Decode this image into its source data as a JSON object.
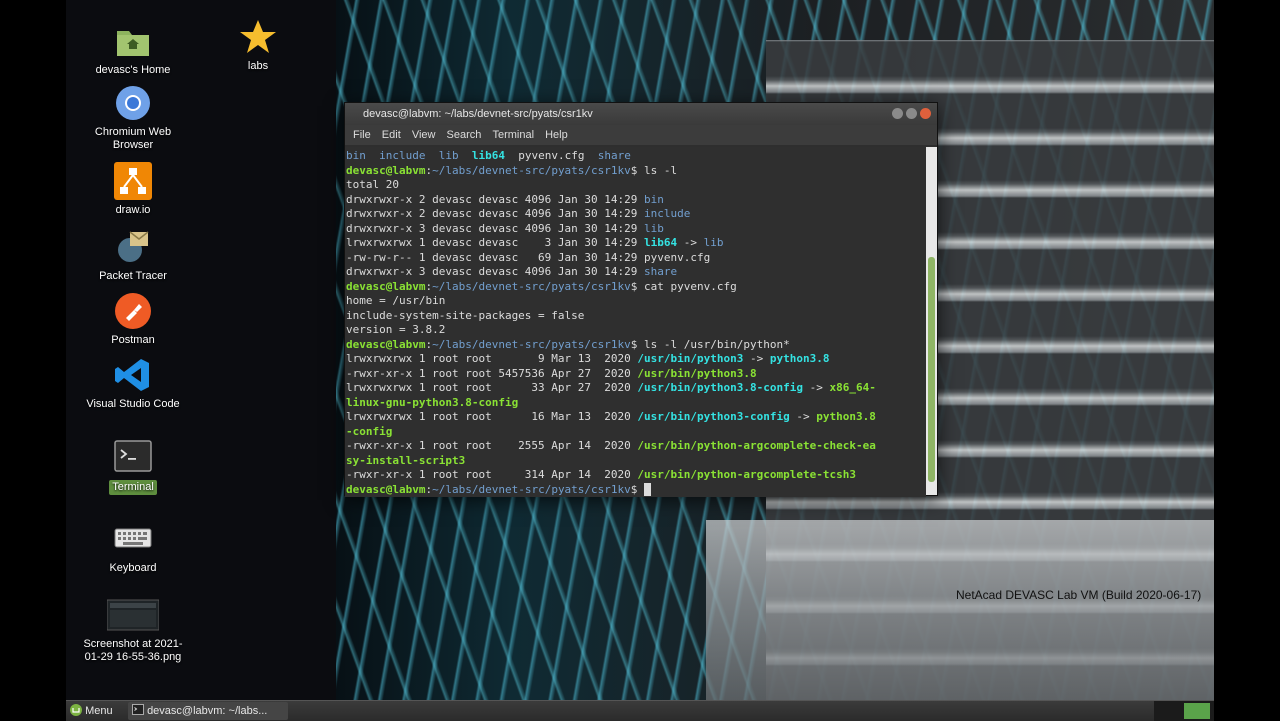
{
  "desktop": {
    "icons": [
      {
        "label": "devasc's Home",
        "icon": "folder-home-icon"
      },
      {
        "label": "labs",
        "icon": "star-icon"
      },
      {
        "label": "Chromium Web Browser",
        "icon": "chromium-icon"
      },
      {
        "label": "draw.io",
        "icon": "drawio-icon"
      },
      {
        "label": "Packet Tracer",
        "icon": "packet-tracer-icon"
      },
      {
        "label": "Postman",
        "icon": "postman-icon"
      },
      {
        "label": "Visual Studio Code",
        "icon": "vscode-icon"
      },
      {
        "label": "Terminal",
        "icon": "terminal-icon"
      },
      {
        "label": "Keyboard",
        "icon": "keyboard-icon"
      },
      {
        "label": "Screenshot at 2021-01-29 16-55-36.png",
        "icon": "image-thumbnail-icon"
      }
    ],
    "watermark": "NetAcad DEVASC Lab VM (Build 2020-06-17)"
  },
  "terminal": {
    "title": "devasc@labvm: ~/labs/devnet-src/pyats/csr1kv",
    "menu": [
      "File",
      "Edit",
      "View",
      "Search",
      "Terminal",
      "Help"
    ],
    "prompt_user": "devasc@labvm",
    "prompt_path": "~/labs/devnet-src/pyats/csr1kv",
    "lines": {
      "l1": [
        "bin",
        "include",
        "lib",
        "lib64",
        "pyvenv.cfg",
        "share"
      ],
      "cmd1": "ls -l",
      "total": "total 20",
      "ls1": [
        {
          "perm": "drwxrwxr-x 2 devasc devasc 4096 Jan 30 14:29 ",
          "name": "bin"
        },
        {
          "perm": "drwxrwxr-x 2 devasc devasc 4096 Jan 30 14:29 ",
          "name": "include"
        },
        {
          "perm": "drwxrwxr-x 3 devasc devasc 4096 Jan 30 14:29 ",
          "name": "lib"
        },
        {
          "perm": "lrwxrwxrwx 1 devasc devasc    3 Jan 30 14:29 ",
          "name": "lib64",
          "arrow": " -> ",
          "target": "lib"
        },
        {
          "perm": "-rw-rw-r-- 1 devasc devasc   69 Jan 30 14:29 ",
          "name": "pyvenv.cfg"
        },
        {
          "perm": "drwxrwxr-x 3 devasc devasc 4096 Jan 30 14:29 ",
          "name": "share"
        }
      ],
      "cmd2": "cat pyvenv.cfg",
      "cfg": [
        "home = /usr/bin",
        "include-system-site-packages = false",
        "version = 3.8.2"
      ],
      "cmd3": "ls -l /usr/bin/python*",
      "ls2": [
        {
          "perm": "lrwxrwxrwx 1 root root       9 Mar 13  2020 ",
          "name": "/usr/bin/python3",
          "arrow": " -> ",
          "target": "python3.8"
        },
        {
          "perm": "-rwxr-xr-x 1 root root 5457536 Apr 27  2020 ",
          "name": "/usr/bin/python3.8"
        },
        {
          "perm": "lrwxrwxrwx 1 root root      33 Apr 27  2020 ",
          "name": "/usr/bin/python3.8-config",
          "arrow": " -> ",
          "target": "x86_64-",
          "wrap": "linux-gnu-python3.8-config"
        },
        {
          "perm": "lrwxrwxrwx 1 root root      16 Mar 13  2020 ",
          "name": "/usr/bin/python3-config",
          "arrow": " -> ",
          "target": "python3.8",
          "wrap": "-config"
        },
        {
          "perm": "-rwxr-xr-x 1 root root    2555 Apr 14  2020 ",
          "name": "/usr/bin/python-argcomplete-check-ea",
          "wrap": "sy-install-script3"
        },
        {
          "perm": "-rwxr-xr-x 1 root root     314 Apr 14  2020 ",
          "name": "/usr/bin/python-argcomplete-tcsh3"
        }
      ]
    }
  },
  "taskbar": {
    "menu_label": "Menu",
    "task_label": "devasc@labvm: ~/labs..."
  }
}
